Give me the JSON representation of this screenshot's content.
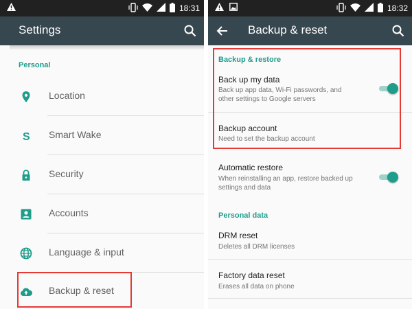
{
  "colors": {
    "accent": "#1e9d8b",
    "toolbar": "#37474f",
    "statusbar": "#212121",
    "highlight_box": "#e53935"
  },
  "left_screen": {
    "status": {
      "icons": [
        "warning-icon",
        "vibrate-icon",
        "wifi-icon",
        "signal-icon",
        "battery-icon"
      ],
      "time": "18:31"
    },
    "toolbar": {
      "title": "Settings",
      "icon": "search-icon"
    },
    "section": "Personal",
    "items": [
      {
        "label": "Location",
        "icon": "location-pin-icon"
      },
      {
        "label": "Smart Wake",
        "icon": "smart-wake-s-icon"
      },
      {
        "label": "Security",
        "icon": "lock-icon"
      },
      {
        "label": "Accounts",
        "icon": "account-box-icon"
      },
      {
        "label": "Language & input",
        "icon": "globe-icon"
      },
      {
        "label": "Backup & reset",
        "icon": "cloud-upload-icon"
      }
    ]
  },
  "right_screen": {
    "status": {
      "icons": [
        "warning-icon",
        "image-icon",
        "vibrate-icon",
        "wifi-icon",
        "signal-icon",
        "battery-icon"
      ],
      "time": "18:32"
    },
    "toolbar": {
      "title": "Backup & reset",
      "back_icon": "back-arrow-icon",
      "icon": "search-icon"
    },
    "sections": [
      {
        "header": "Backup & restore",
        "items": [
          {
            "title": "Back up my data",
            "summary": "Back up app data, Wi-Fi passwords, and other settings to Google servers",
            "switch_on": true
          },
          {
            "title": "Backup account",
            "summary": "Need to set the backup account"
          },
          {
            "title": "Automatic restore",
            "summary": "When reinstalling an app, restore backed up settings and data",
            "switch_on": true
          }
        ]
      },
      {
        "header": "Personal data",
        "items": [
          {
            "title": "DRM reset",
            "summary": "Deletes all DRM licenses"
          },
          {
            "title": "Factory data reset",
            "summary": "Erases all data on phone"
          }
        ]
      }
    ]
  }
}
